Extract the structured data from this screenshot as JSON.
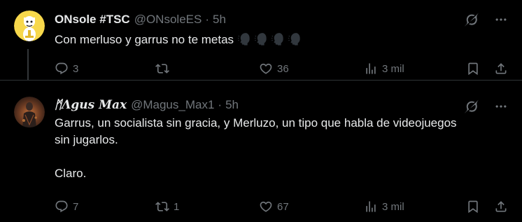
{
  "tweets": [
    {
      "display_name": "ONsole #TSC",
      "handle": "@ONsoleES",
      "separator": "·",
      "time": "5h",
      "text": "Con merluso y garrus no te metas",
      "emojis": [
        "speaking-head",
        "speaking-head",
        "speaking-head",
        "speaking-head"
      ],
      "stats": {
        "replies": "3",
        "reposts": "",
        "likes": "36",
        "views": "3 mil"
      }
    },
    {
      "display_name": "ᛗΛgus Max",
      "handle": "@Magus_Max1",
      "separator": "·",
      "time": "5h",
      "text": "Garrus, un socialista sin gracia, y Merluzo, un tipo que habla de videojuegos\nsin jugarlos.\n\nClaro.",
      "stats": {
        "replies": "7",
        "reposts": "1",
        "likes": "67",
        "views": "3 mil"
      }
    }
  ],
  "colors": {
    "background": "#000000",
    "text": "#e7e9ea",
    "muted": "#71767b",
    "divider": "#2f3336",
    "emoji_blue": "#31373d"
  },
  "icons": [
    "grok-icon",
    "more-icon",
    "reply-icon",
    "repost-icon",
    "like-icon",
    "views-icon",
    "bookmark-icon",
    "share-icon"
  ]
}
